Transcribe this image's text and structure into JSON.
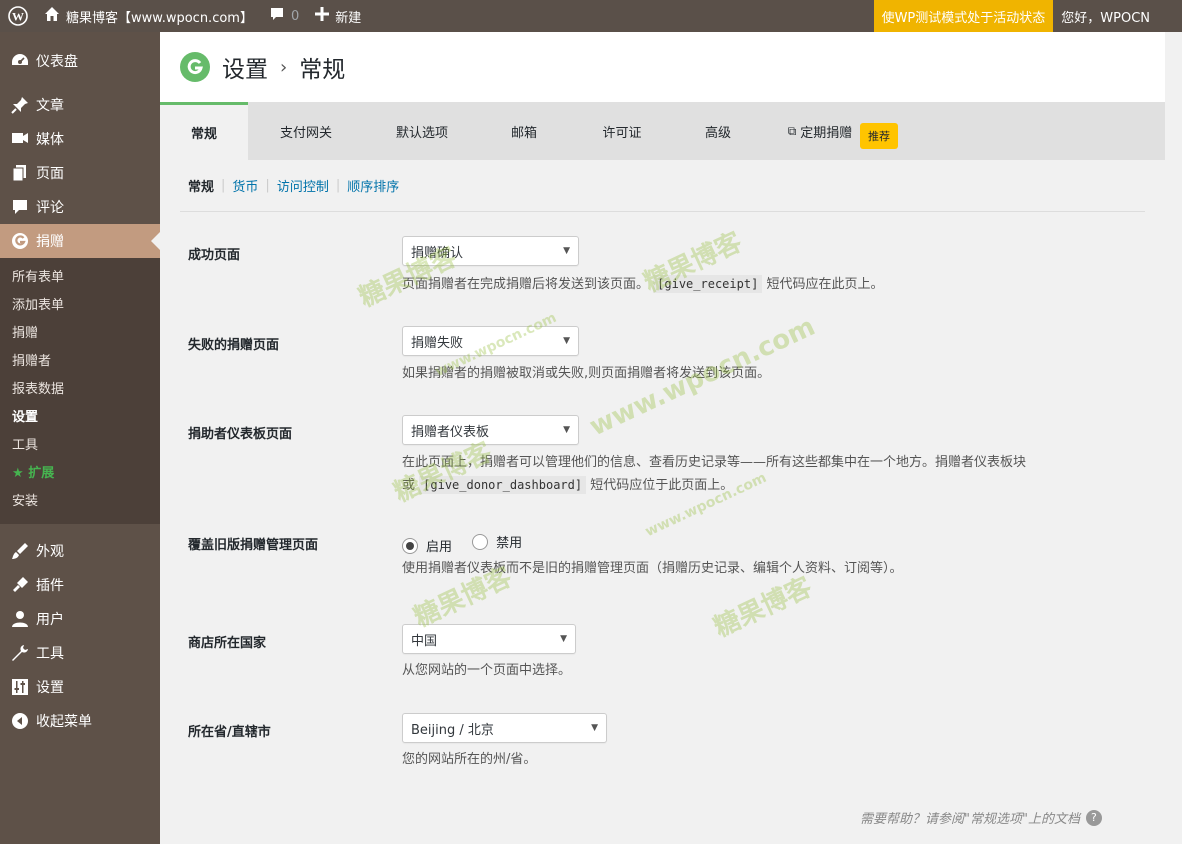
{
  "adminbar": {
    "site_name": "糖果博客【www.wpocn.com】",
    "comments_count": "0",
    "new_label": "新建",
    "test_mode": "使WP测试模式处于活动状态",
    "greeting": "您好，WPOCN"
  },
  "sidebar": {
    "items_top": [
      {
        "label": "仪表盘",
        "icon": "dashboard-icon"
      },
      {
        "label": "文章",
        "icon": "pin-icon"
      },
      {
        "label": "媒体",
        "icon": "media-icon"
      },
      {
        "label": "页面",
        "icon": "page-icon"
      },
      {
        "label": "评论",
        "icon": "comment-icon"
      },
      {
        "label": "捐赠",
        "icon": "give-icon"
      }
    ],
    "submenu": [
      "所有表单",
      "添加表单",
      "捐赠",
      "捐赠者",
      "报表数据",
      "设置",
      "工具",
      "扩展",
      "安装"
    ],
    "items_bottom": [
      {
        "label": "外观",
        "icon": "brush-icon"
      },
      {
        "label": "插件",
        "icon": "plugin-icon"
      },
      {
        "label": "用户",
        "icon": "user-icon"
      },
      {
        "label": "工具",
        "icon": "wrench-icon"
      },
      {
        "label": "设置",
        "icon": "settings-icon"
      },
      {
        "label": "收起菜单",
        "icon": "collapse-icon"
      }
    ]
  },
  "header": {
    "title": "设置",
    "subtitle": "常规"
  },
  "tabs": [
    "常规",
    "支付网关",
    "默认选项",
    "邮箱",
    "许可证",
    "高级",
    "定期捐赠"
  ],
  "tab_badge": "推荐",
  "subsections": [
    "常规",
    "货币",
    "访问控制",
    "顺序排序"
  ],
  "fields": {
    "success_page": {
      "label": "成功页面",
      "value": "捐赠确认",
      "desc_before": "页面捐赠者在完成捐赠后将发送到该页面。",
      "code": "[give_receipt]",
      "desc_after": "短代码应在此页上。"
    },
    "failure_page": {
      "label": "失败的捐赠页面",
      "value": "捐赠失败",
      "desc": "如果捐赠者的捐赠被取消或失败,则页面捐赠者将发送到该页面。"
    },
    "donor_dashboard": {
      "label": "捐助者仪表板页面",
      "value": "捐赠者仪表板",
      "desc_line1": "在此页面上，捐赠者可以管理他们的信息、查看历史记录等——所有这些都集中在一个地方。捐赠者仪表板块",
      "desc_or": "或",
      "code": "[give_donor_dashboard]",
      "desc_after": "短代码应位于此页面上。"
    },
    "override_legacy": {
      "label": "覆盖旧版捐赠管理页面",
      "enable": "启用",
      "disable": "禁用",
      "selected": "启用",
      "desc": "使用捐赠者仪表板而不是旧的捐赠管理页面（捐赠历史记录、编辑个人资料、订阅等）。"
    },
    "base_country": {
      "label": "商店所在国家",
      "value": "中国",
      "desc": "从您网站的一个页面中选择。"
    },
    "base_state": {
      "label": "所在省/直辖市",
      "value": "Beijing / 北京",
      "desc": "您的网站所在的州/省。"
    }
  },
  "help_text": "需要帮助？请参阅\"常规选项\"上的文档",
  "watermarks": [
    "糖果博客",
    "糖果博客",
    "www.wpocn.com",
    "www.wpocn.com",
    "糖果博客",
    "www.wpocn.com",
    "糖果博客",
    "糖果博客",
    "www.wpocn.com"
  ]
}
